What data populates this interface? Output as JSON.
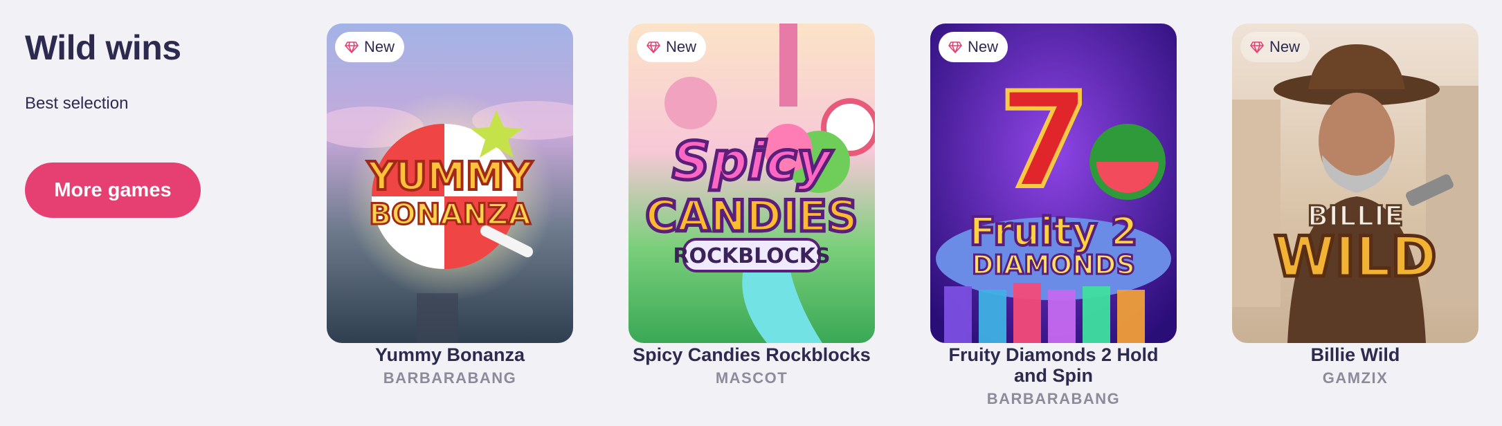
{
  "section": {
    "title": "Wild wins",
    "subtitle": "Best selection",
    "more_button": "More games"
  },
  "badge_icon": "diamond-icon",
  "accent_color": "#e63f71",
  "games": [
    {
      "badge": "New",
      "title": "Yummy Bonanza",
      "provider": "BARBARABANG",
      "logo_line1": "YUMMY",
      "logo_line2": "BONANZA"
    },
    {
      "badge": "New",
      "title": "Spicy Candies Rockblocks",
      "provider": "MASCOT",
      "logo_line1": "Spicy",
      "logo_line2": "CANDIES",
      "logo_line3": "ROCKBLOCKS"
    },
    {
      "badge": "New",
      "title": "Fruity Diamonds 2 Hold and Spin",
      "provider": "BARBARABANG",
      "logo_line1": "7",
      "logo_line2": "Fruity 2",
      "logo_line3": "DIAMONDS"
    },
    {
      "badge": "New",
      "title": "Billie Wild",
      "provider": "GAMZIX",
      "logo_line1": "BILLIE",
      "logo_line2": "WILD"
    }
  ]
}
